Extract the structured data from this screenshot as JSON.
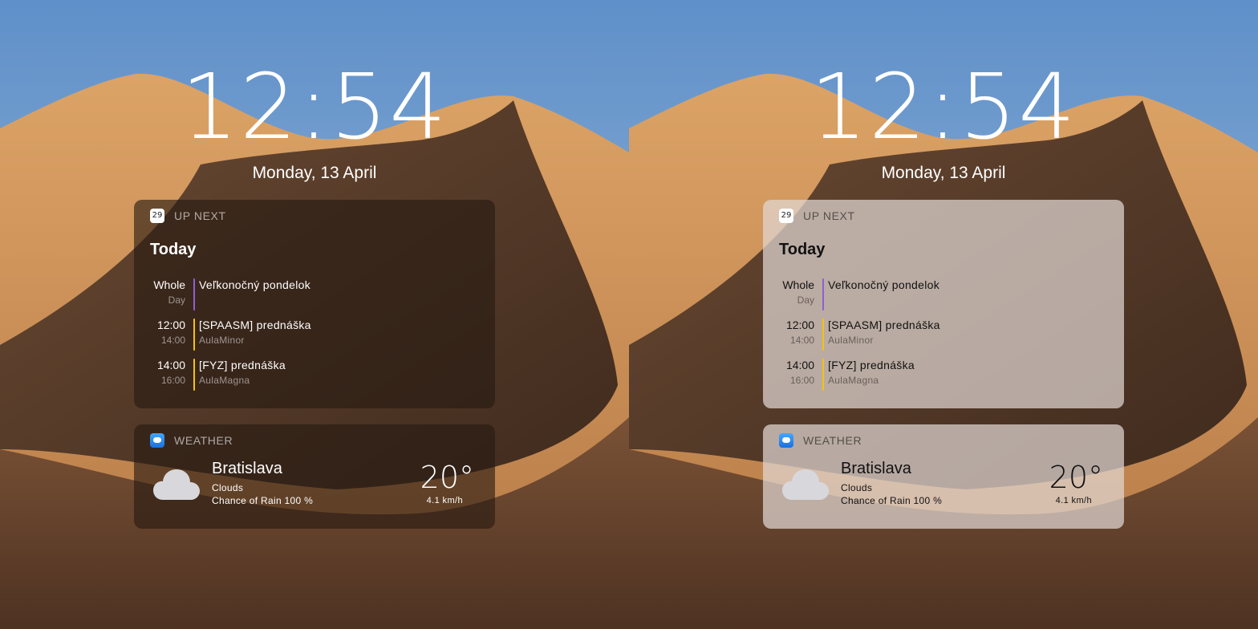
{
  "lock_screen": {
    "time": "12:54",
    "date": "Monday, 13 April"
  },
  "up_next": {
    "header": "UP NEXT",
    "calendar_icon_day": "29",
    "section": "Today",
    "events": [
      {
        "time_top": "Whole",
        "time_bottom": "Day",
        "title": "Veľkonočný pondelok",
        "location": "",
        "color": "#8e5fd6"
      },
      {
        "time_top": "12:00",
        "time_bottom": "14:00",
        "title": "[SPAASM] prednáška",
        "location": "AulaMinor",
        "color": "#f5c211"
      },
      {
        "time_top": "14:00",
        "time_bottom": "16:00",
        "title": "[FYZ] prednáška",
        "location": "AulaMagna",
        "color": "#f5c211"
      }
    ]
  },
  "weather": {
    "header": "WEATHER",
    "city": "Bratislava",
    "condition": "Clouds",
    "rain": "Chance of Rain 100 %",
    "temperature": "20°",
    "wind": "4.1 km/h",
    "icon": "cloud-icon"
  },
  "colors": {
    "sky": "#6d9ad0",
    "dune_light": "#d69b5c",
    "dune_shadow": "#5a3d2a",
    "dark_widget": "#2a1d14",
    "light_widget": "#d9cbc4"
  }
}
